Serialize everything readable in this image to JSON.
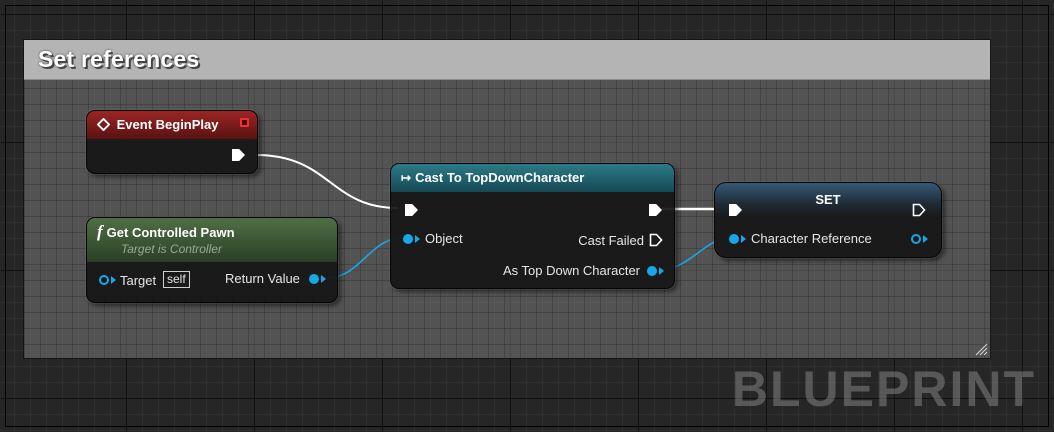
{
  "comment": {
    "title": "Set references"
  },
  "nodes": {
    "event_begin_play": {
      "title": "Event BeginPlay",
      "icon": "event-diamond-icon",
      "header_color": "#7a1a1a"
    },
    "get_controlled_pawn": {
      "title": "Get Controlled Pawn",
      "subtitle": "Target is Controller",
      "icon": "function-icon",
      "header_color": "#2f4a2a",
      "inputs": [
        {
          "label": "Target",
          "default": "self"
        }
      ],
      "outputs": [
        {
          "label": "Return Value"
        }
      ]
    },
    "cast_to_topdown": {
      "title": "Cast To TopDownCharacter",
      "icon": "cast-arrow-icon",
      "header_color": "#1f5a66",
      "inputs": [
        {
          "label": "Object"
        }
      ],
      "outputs": [
        {
          "label": "Cast Failed"
        },
        {
          "label": "As Top Down Character"
        }
      ]
    },
    "set_node": {
      "title": "SET",
      "header_color": "#2a3d4f",
      "inputs": [
        {
          "label": "Character Reference"
        }
      ]
    }
  },
  "colors": {
    "object_pin": "#16a7e8",
    "exec_wire": "#ffffff",
    "object_wire": "#16a7e8"
  },
  "watermark": "BLUEPRINT"
}
